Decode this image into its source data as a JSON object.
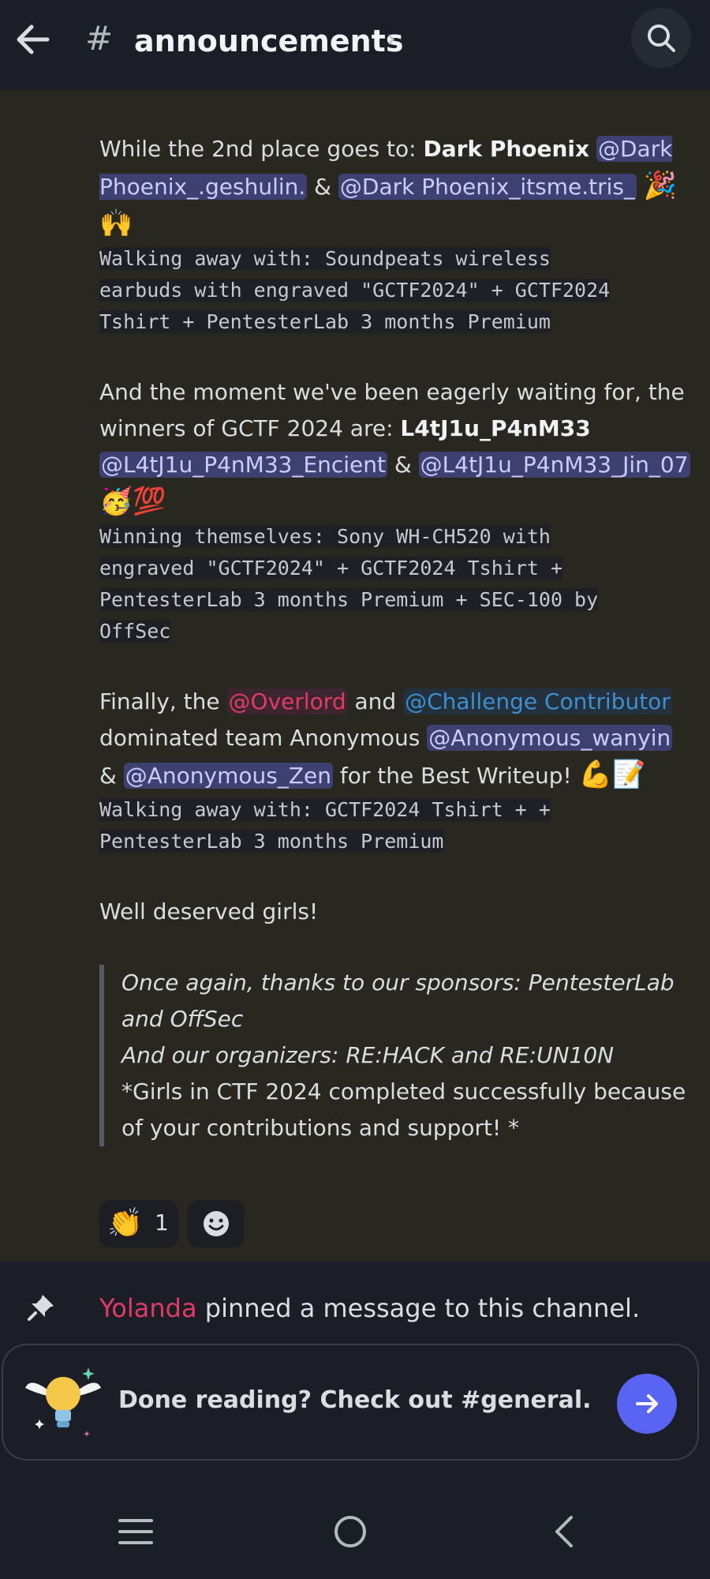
{
  "header": {
    "hash": "#",
    "channel_name": "announcements",
    "chevron": "›",
    "back_icon": "arrow-left-icon",
    "search_icon": "search-icon"
  },
  "messages": {
    "second_place": {
      "intro": "While the 2nd place goes to: ",
      "team": "Dark Phoenix",
      "mention1": "@Dark Phoenix_.geshulin.",
      "amp": " & ",
      "mention2": "@Dark Phoenix_itsme.tris_",
      "emojis": "🎉🙌",
      "prize_lines": [
        "Walking away with: Soundpeats wireless",
        "earbuds with engraved \"GCTF2024\" + GCTF2024",
        "Tshirt + PentesterLab 3 months Premium"
      ]
    },
    "winners": {
      "intro": "And the moment we've been eagerly waiting for, the winners of GCTF 2024 are: ",
      "team": "L4tJ1u_P4nM33",
      "mention1": "@L4tJ1u_P4nM33_Encient",
      "amp": " & ",
      "mention2": "@L4tJ1u_P4nM33_Jin_07",
      "emojis": "🥳💯",
      "prize_lines": [
        "Winning themselves: Sony WH-CH520 with",
        "engraved \"GCTF2024\" + GCTF2024 Tshirt +",
        "PentesterLab 3 months Premium + SEC-100 by",
        "OffSec"
      ]
    },
    "writeup": {
      "intro": "Finally, the ",
      "role1": "@Overlord",
      "and": " and ",
      "role2": "@Challenge Contributor",
      "mid": " dominated team Anonymous ",
      "mention1": "@Anonymous_wanyin",
      "amp": " & ",
      "mention2": "@Anonymous_Zen",
      "outro": " for the Best Writeup! ",
      "emojis": "💪📝",
      "prize_lines": [
        "Walking away with: GCTF2024 Tshirt + +",
        "PentesterLab 3 months Premium"
      ]
    },
    "closing": "Well deserved girls!",
    "quote": {
      "line1": "Once again, thanks to our sponsors: PentesterLab and OffSec",
      "line2": "And our organizers: RE:HACK and RE:UN10N",
      "line3": "*Girls in CTF 2024 completed successfully because of your contributions and support! *"
    },
    "reactions": [
      {
        "emoji": "👏",
        "count": "1"
      }
    ],
    "add_reaction_icon": "smiley-face-icon"
  },
  "pinned": {
    "user": "Yolanda",
    "text": " pinned a message to this channel.",
    "icon": "pin-icon"
  },
  "done_card": {
    "text": "Done reading? Check out #general.",
    "icon": "lightbulb-icon",
    "button_icon": "arrow-right-icon",
    "accent": "#5865f2"
  },
  "colors": {
    "background": "#1b1e27",
    "message_area": "#282821",
    "mention_bg": "#3e4072",
    "mention_text": "#c9cdfb",
    "role_red": "#e03b66",
    "role_blue": "#3f8fcd"
  }
}
